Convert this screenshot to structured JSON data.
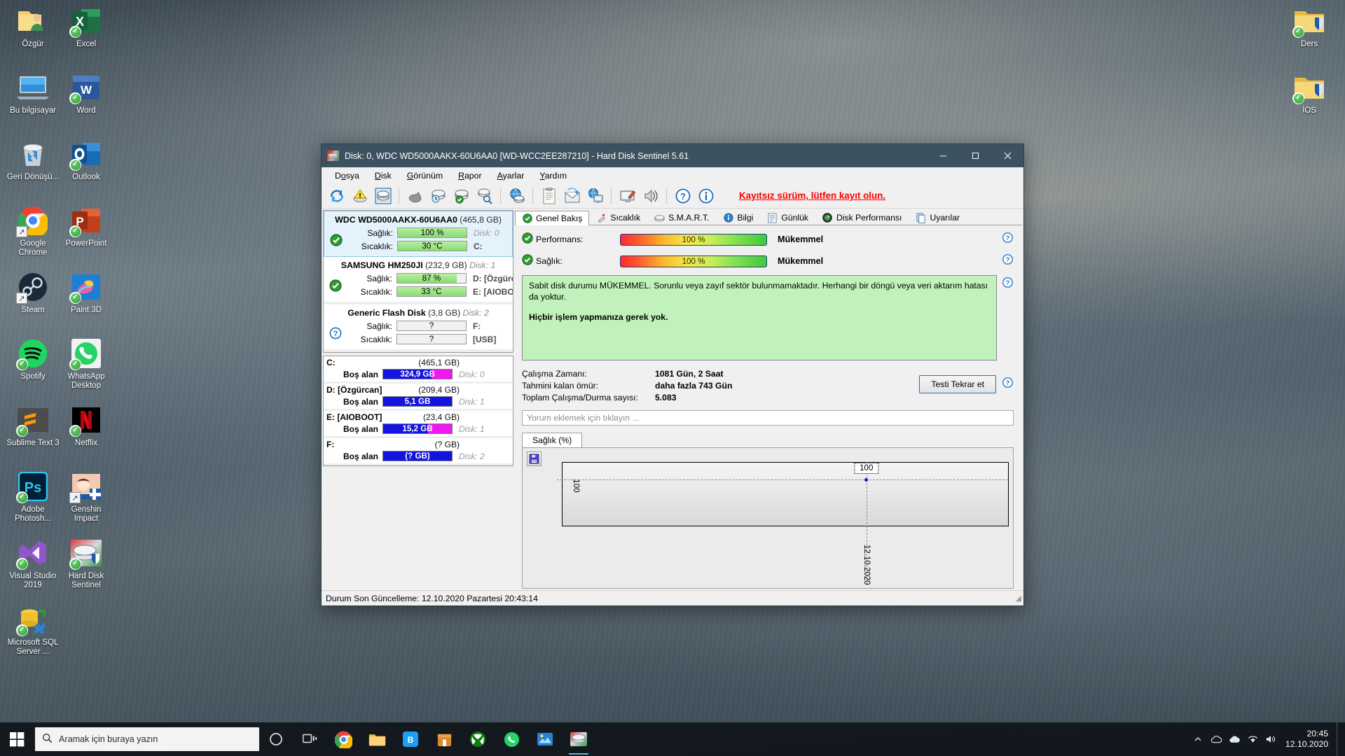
{
  "desktop": {
    "icons_left_col1": [
      {
        "label": "Özgür",
        "icon": "user-folder-icon",
        "badge": "none"
      },
      {
        "label": "Bu bilgisayar",
        "icon": "this-pc-icon",
        "badge": "none"
      },
      {
        "label": "Geri Dönüşü...",
        "icon": "recycle-bin-icon",
        "badge": "none"
      },
      {
        "label": "Google Chrome",
        "icon": "chrome-icon",
        "badge": "shortcut"
      },
      {
        "label": "Steam",
        "icon": "steam-icon",
        "badge": "shortcut"
      },
      {
        "label": "Spotify",
        "icon": "spotify-icon",
        "badge": "check"
      },
      {
        "label": "Sublime Text 3",
        "icon": "sublime-text-icon",
        "badge": "check"
      },
      {
        "label": "Adobe Photosh...",
        "icon": "photoshop-icon",
        "badge": "check"
      },
      {
        "label": "Visual Studio 2019",
        "icon": "visual-studio-icon",
        "badge": "check"
      },
      {
        "label": "Microsoft SQL Server ...",
        "icon": "sql-server-icon",
        "badge": "check"
      }
    ],
    "icons_left_col2": [
      {
        "label": "Excel",
        "icon": "excel-icon",
        "badge": "check"
      },
      {
        "label": "Word",
        "icon": "word-icon",
        "badge": "check"
      },
      {
        "label": "Outlook",
        "icon": "outlook-icon",
        "badge": "check"
      },
      {
        "label": "PowerPoint",
        "icon": "powerpoint-icon",
        "badge": "check"
      },
      {
        "label": "Paint 3D",
        "icon": "paint3d-icon",
        "badge": "check"
      },
      {
        "label": "WhatsApp Desktop",
        "icon": "whatsapp-icon",
        "badge": "check"
      },
      {
        "label": "Netflix",
        "icon": "netflix-icon",
        "badge": "check"
      },
      {
        "label": "Genshin Impact",
        "icon": "genshin-impact-icon",
        "badge": "shortcut"
      },
      {
        "label": "Hard Disk Sentinel",
        "icon": "hard-disk-sentinel-icon",
        "badge": "check"
      }
    ],
    "icons_right_col": [
      {
        "label": "Ders",
        "icon": "folder-icon",
        "badge": "check"
      },
      {
        "label": "İOS",
        "icon": "folder-icon",
        "badge": "check"
      }
    ]
  },
  "window": {
    "title": "Disk: 0, WDC WD5000AAKX-60U6AA0 [WD-WCC2EE287210]  -  Hard Disk Sentinel 5.61",
    "app_icon": "hdd-app-icon",
    "buttons": {
      "minimize": "minimize-icon",
      "maximize": "maximize-icon",
      "close": "close-icon"
    }
  },
  "menubar": [
    {
      "pre": "D",
      "mid": "o",
      "post": "sya"
    },
    {
      "pre": "",
      "mid": "D",
      "post": "isk"
    },
    {
      "pre": "",
      "mid": "G",
      "post": "örünüm"
    },
    {
      "pre": "",
      "mid": "R",
      "post": "apor"
    },
    {
      "pre": "",
      "mid": "A",
      "post": "yarlar"
    },
    {
      "pre": "",
      "mid": "Y",
      "post": "ardım"
    }
  ],
  "toolbar": {
    "buttons": [
      "refresh-icon",
      "warning-disk-icon",
      "disk-info-icon",
      "disk-gray-icon",
      "disk-clock-icon",
      "disk-check-icon",
      "disk-search-icon",
      "network-disk-icon",
      "report-icon",
      "send-report-icon",
      "network-monitor-icon",
      "screen-config-icon",
      "alert-sound-icon",
      "help-icon",
      "info-icon"
    ],
    "register_text": "Kayıtsız sürüm, lütfen kayıt olun."
  },
  "left_panel": {
    "disks": [
      {
        "name": "WDC WD5000AAKX-60U6AA0",
        "capacity": "(465,8 GB)",
        "disk_no": "Disk: 0",
        "status_icon": "ok-check-icon",
        "selected": true,
        "health_label": "Sağlık:",
        "health_value": "100 %",
        "health_pct": 100,
        "temp_label": "Sıcaklık:",
        "temp_value": "30 °C",
        "temp_pct": 100,
        "right1": "Disk: 0",
        "right2": "C:"
      },
      {
        "name": "SAMSUNG HM250JI",
        "capacity": "(232,9 GB)",
        "disk_no": "Disk: 1",
        "status_icon": "ok-check-icon",
        "selected": false,
        "health_label": "Sağlık:",
        "health_value": "87 %",
        "health_pct": 87,
        "temp_label": "Sıcaklık:",
        "temp_value": "33 °C",
        "temp_pct": 100,
        "right1": "D: [Özgürcan]",
        "right2": "E: [AIOBOOT]"
      },
      {
        "name": "Generic Flash Disk",
        "capacity": "(3,8 GB)",
        "disk_no": "Disk: 2",
        "status_icon": "unknown-question-icon",
        "selected": false,
        "health_label": "Sağlık:",
        "health_value": "?",
        "health_pct": 0,
        "temp_label": "Sıcaklık:",
        "temp_value": "?",
        "temp_pct": 0,
        "right1": "F:",
        "right2": "[USB]"
      }
    ],
    "volumes": [
      {
        "letter": "C:",
        "capacity": "(465,1 GB)",
        "free_label": "Boş alan",
        "free": "324,9 GB",
        "fill_pct": 70,
        "disk_no": "Disk: 0"
      },
      {
        "letter": "D: [Özgürcan]",
        "capacity": "(209,4 GB)",
        "free_label": "Boş alan",
        "free": "5,1 GB",
        "fill_pct": 100,
        "disk_no": "Disk: 1"
      },
      {
        "letter": "E: [AIOBOOT]",
        "capacity": "(23,4 GB)",
        "free_label": "Boş alan",
        "free": "15,2 GB",
        "fill_pct": 65,
        "disk_no": "Disk: 1"
      },
      {
        "letter": "F:",
        "capacity": "(? GB)",
        "free_label": "Boş alan",
        "free": "(? GB)",
        "fill_pct": 100,
        "disk_no": "Disk: 2"
      }
    ]
  },
  "tabs": [
    {
      "label": "Genel Bakış",
      "icon": "overview-check-icon",
      "active": true
    },
    {
      "label": "Sıcaklık",
      "icon": "thermometer-icon",
      "active": false
    },
    {
      "label": "S.M.A.R.T.",
      "icon": "smart-disk-icon",
      "active": false
    },
    {
      "label": "Bilgi",
      "icon": "info-icon",
      "active": false
    },
    {
      "label": "Günlük",
      "icon": "log-document-icon",
      "active": false
    },
    {
      "label": "Disk Performansı",
      "icon": "gauge-icon",
      "active": false
    },
    {
      "label": "Uyarılar",
      "icon": "alerts-copy-icon",
      "active": false
    }
  ],
  "overview": {
    "meters": [
      {
        "icon": "ok-check-icon",
        "label": "Performans:",
        "value": "100 %",
        "pct": 100,
        "state": "Mükemmel",
        "help": "help-icon"
      },
      {
        "icon": "ok-check-icon",
        "label": "Sağlık:",
        "value": "100 %",
        "pct": 100,
        "state": "Mükemmel",
        "help": "help-icon"
      }
    ],
    "status_text": "Sabit disk durumu MÜKEMMEL. Sorunlu veya zayıf sektör bulunmamaktadır. Herhangi bir döngü veya veri aktarım hatası da yoktur.",
    "status_bold": "Hiçbir işlem yapmanıza gerek yok.",
    "status_help": "help-icon",
    "info": [
      {
        "key": "Çalışma Zamanı:",
        "value": "1081 Gün, 2 Saat"
      },
      {
        "key": "Tahmini kalan ömür:",
        "value": "daha fazla 743 Gün"
      },
      {
        "key": "Toplam Çalışma/Durma sayısı:",
        "value": "5.083"
      }
    ],
    "retest_button": "Testi Tekrar et",
    "retest_help": "help-icon",
    "comment_placeholder": "Yorum eklemek için tıklayın ..."
  },
  "chart_data": {
    "type": "line",
    "title": "Sağlık (%)",
    "tab_label": "Sağlık (%)",
    "save_icon": "save-floppy-icon",
    "x": [
      "12.10.2020"
    ],
    "values": [
      100
    ],
    "point_label": "100",
    "ytick_labels": [
      "100"
    ],
    "xtick_labels": [
      "12.10.2020"
    ],
    "ylabel": "",
    "xlabel": "",
    "ylim": [
      0,
      100
    ],
    "grid": true,
    "legend": false
  },
  "statusbar": {
    "text": "Durum Son Güncelleme: 12.10.2020 Pazartesi 20:43:14"
  },
  "taskbar": {
    "start_icon": "windows-start-icon",
    "search_icon": "search-icon",
    "search_placeholder": "Aramak için buraya yazın",
    "apps": [
      {
        "name": "cortana-icon",
        "active": false
      },
      {
        "name": "task-view-icon",
        "active": false
      },
      {
        "name": "chrome-icon",
        "active": false
      },
      {
        "name": "file-explorer-icon",
        "active": false
      },
      {
        "name": "bluestacks-icon",
        "active": false
      },
      {
        "name": "store-icon",
        "active": false
      },
      {
        "name": "xbox-icon",
        "active": false
      },
      {
        "name": "whatsapp-icon",
        "active": false
      },
      {
        "name": "paint-icon",
        "active": false
      },
      {
        "name": "hard-disk-sentinel-icon",
        "active": true
      }
    ],
    "tray": [
      "chevron-up-icon",
      "cloud-icon",
      "onedrive-icon",
      "wifi-icon",
      "volume-icon"
    ],
    "clock_time": "20:45",
    "clock_date": "12.10.2020"
  }
}
